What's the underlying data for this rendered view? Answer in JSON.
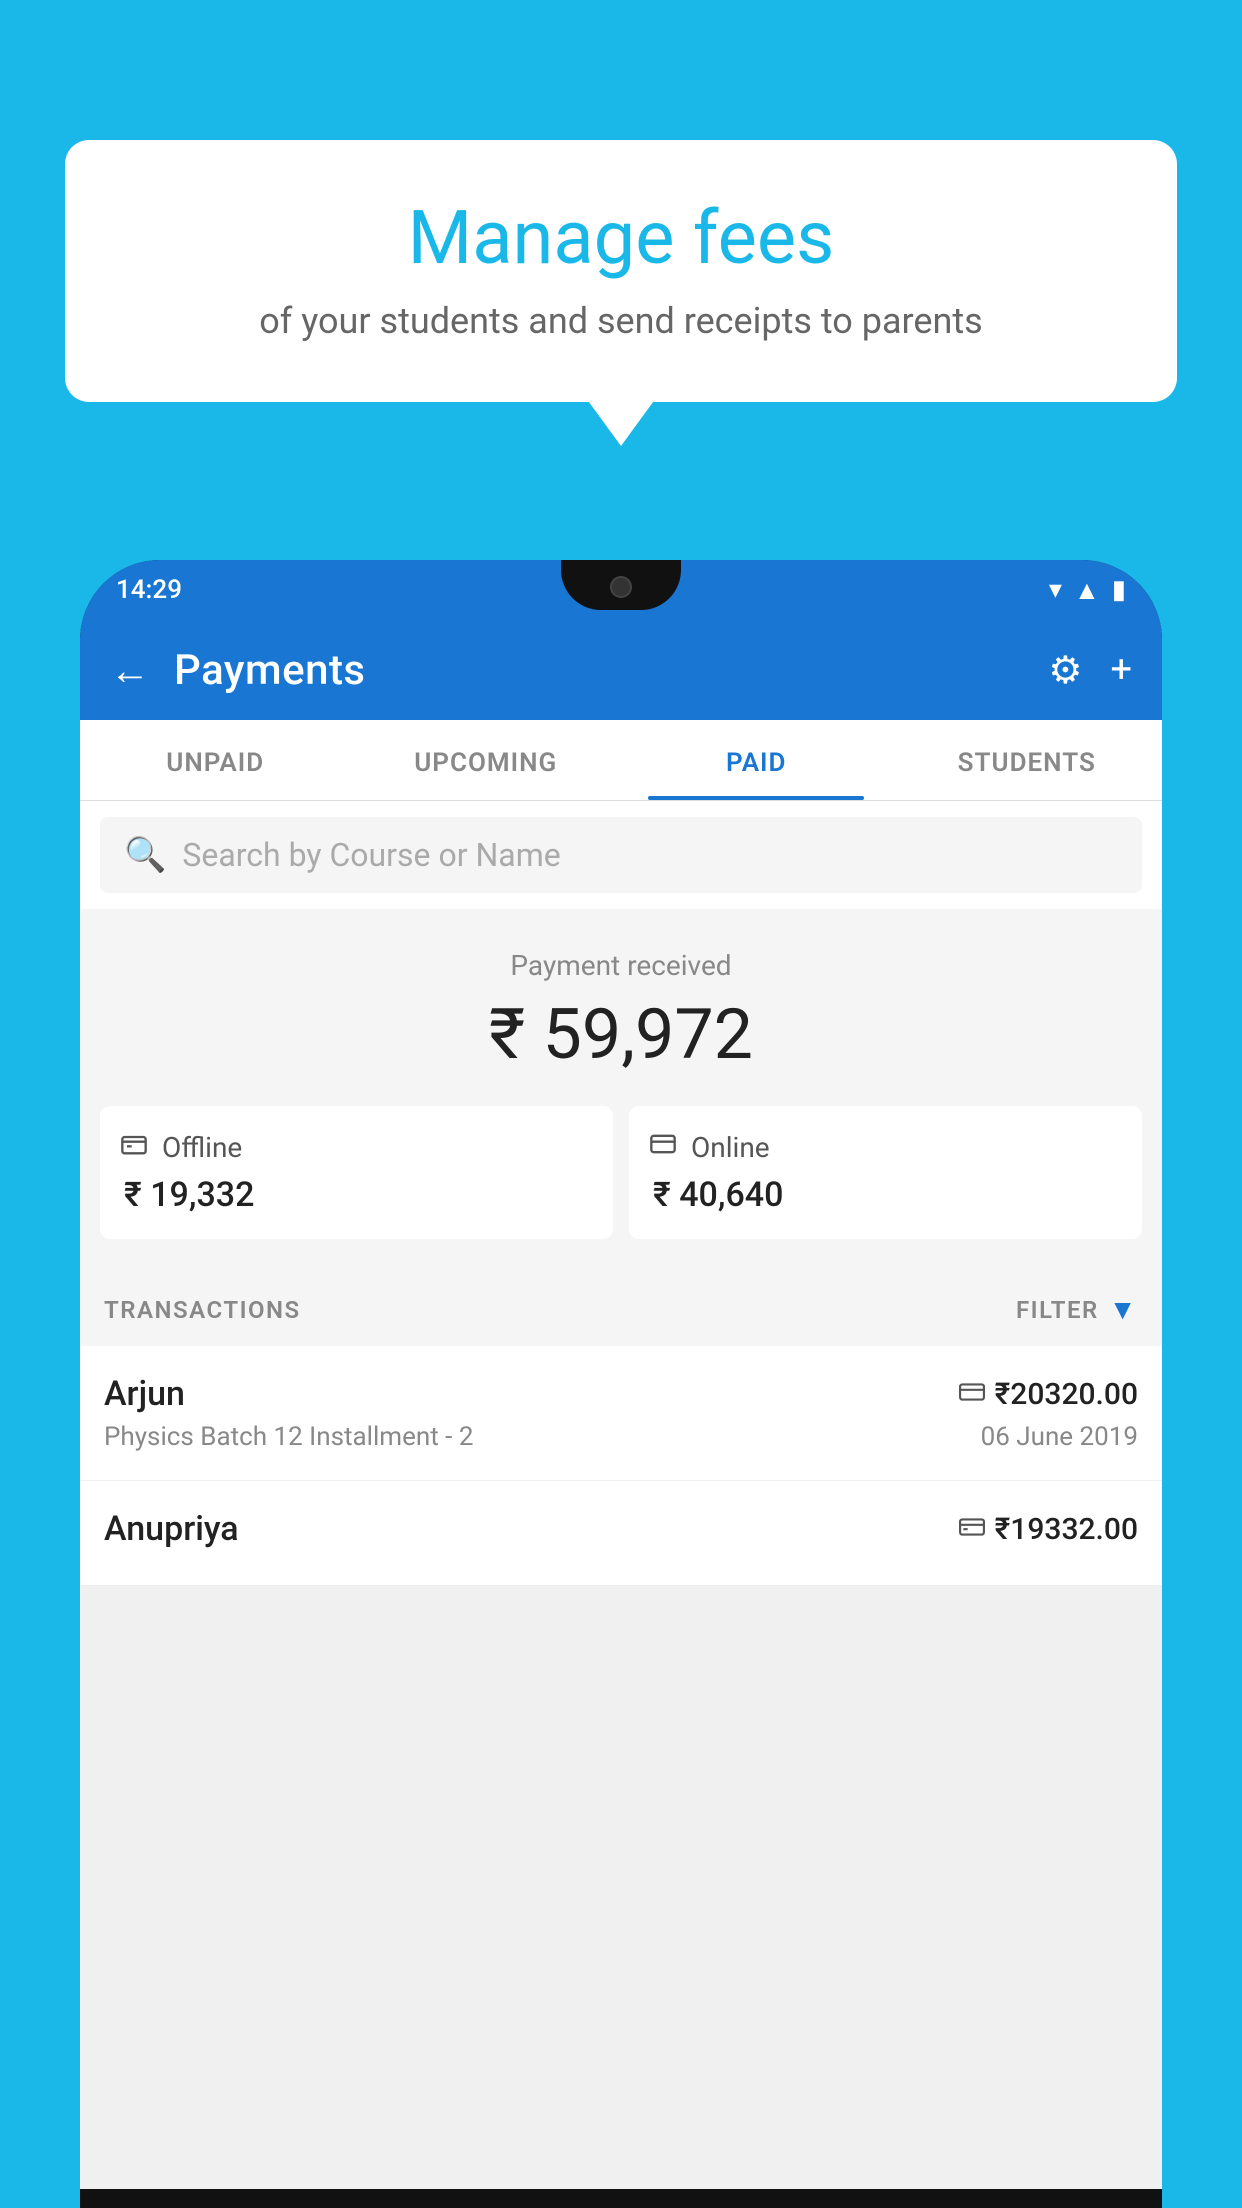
{
  "background_color": "#1ab8e8",
  "speech_bubble": {
    "title": "Manage fees",
    "subtitle": "of your students and send receipts to parents"
  },
  "phone": {
    "status_bar": {
      "time": "14:29",
      "signal_icons": [
        "wifi",
        "bars",
        "battery"
      ]
    },
    "header": {
      "title": "Payments",
      "back_label": "←",
      "settings_icon": "⚙",
      "add_icon": "+"
    },
    "tabs": [
      {
        "label": "UNPAID",
        "active": false
      },
      {
        "label": "UPCOMING",
        "active": false
      },
      {
        "label": "PAID",
        "active": true
      },
      {
        "label": "STUDENTS",
        "active": false
      }
    ],
    "search": {
      "placeholder": "Search by Course or Name"
    },
    "payment_summary": {
      "label": "Payment received",
      "amount": "₹ 59,972",
      "offline": {
        "icon": "💳",
        "label": "Offline",
        "amount": "₹ 19,332"
      },
      "online": {
        "icon": "💳",
        "label": "Online",
        "amount": "₹ 40,640"
      }
    },
    "transactions": {
      "header_label": "TRANSACTIONS",
      "filter_label": "FILTER",
      "rows": [
        {
          "name": "Arjun",
          "course": "Physics Batch 12 Installment - 2",
          "amount": "₹20320.00",
          "date": "06 June 2019",
          "payment_type": "online"
        },
        {
          "name": "Anupriya",
          "course": "",
          "amount": "₹19332.00",
          "date": "",
          "payment_type": "offline"
        }
      ]
    }
  }
}
